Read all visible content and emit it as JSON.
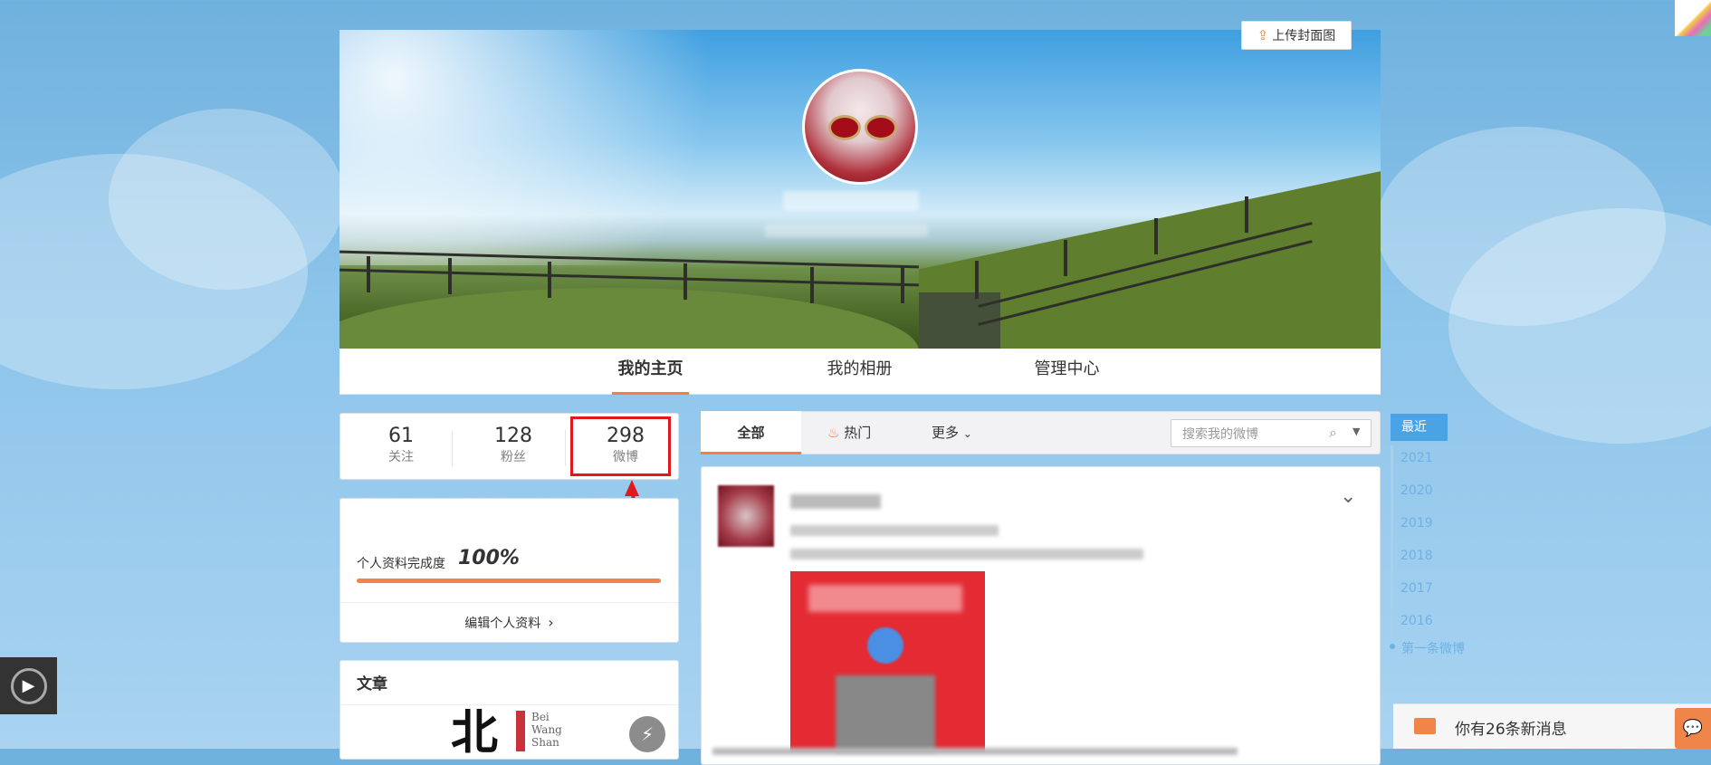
{
  "cover": {
    "upload_label": "上传封面图",
    "upload_icon": "upload-icon"
  },
  "nav": {
    "tabs": [
      {
        "label": "我的主页",
        "active": true
      },
      {
        "label": "我的相册",
        "active": false
      },
      {
        "label": "管理中心",
        "active": false
      }
    ]
  },
  "stats": {
    "following": {
      "value": "61",
      "label": "关注"
    },
    "followers": {
      "value": "128",
      "label": "粉丝"
    },
    "posts": {
      "value": "298",
      "label": "微博"
    }
  },
  "profile": {
    "completeness_label": "个人资料完成度",
    "completeness_value": "100%",
    "completeness_fraction": 1.0,
    "edit_label": "编辑个人资料"
  },
  "article": {
    "title": "文章",
    "logo_text_cn": "北",
    "logo_text_en": [
      "Bei",
      "Wang",
      "Shan"
    ]
  },
  "feed": {
    "tabs": {
      "all": "全部",
      "hot": "热门",
      "more": "更多"
    },
    "search_placeholder": "搜索我的微博"
  },
  "timeline": {
    "recent": "最近",
    "years": [
      "2021",
      "2020",
      "2019",
      "2018",
      "2017",
      "2016"
    ],
    "first": "第一条微博"
  },
  "messages": {
    "text": "你有26条新消息"
  },
  "colors": {
    "accent": "#fa7d3c",
    "highlight": "#e0191e",
    "timeline_blue": "#4aa3e5"
  }
}
